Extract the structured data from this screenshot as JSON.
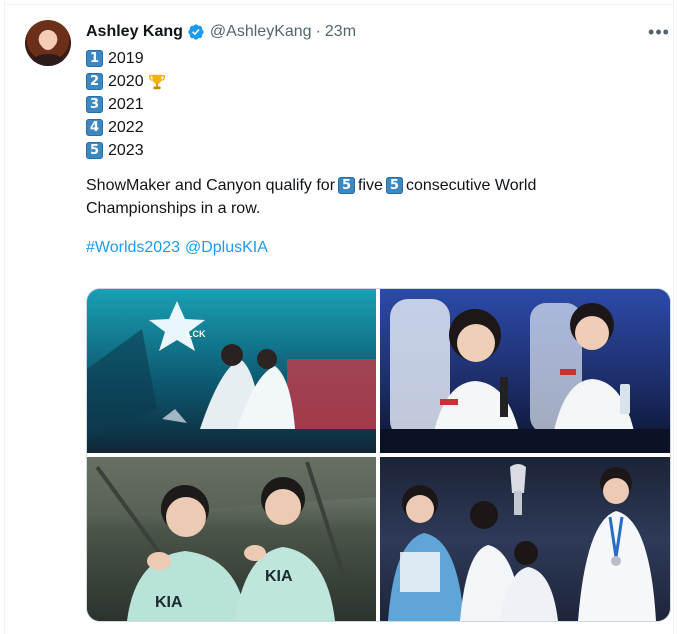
{
  "tweet": {
    "author_name": "Ashley Kang",
    "handle": "@AshleyKang",
    "separator": "·",
    "time": "23m",
    "more_label": "•••",
    "year_list": [
      {
        "number": "1",
        "year": "2019"
      },
      {
        "number": "2",
        "year": "2020"
      },
      {
        "number": "3",
        "year": "2021"
      },
      {
        "number": "4",
        "year": "2022"
      },
      {
        "number": "5",
        "year": "2023"
      }
    ],
    "body_line1_start": "ShowMaker and Canyon qualify for",
    "five_emoji": "5",
    "five_word": "five",
    "body_line1_end": "consecutive World",
    "body_line2": "Championships in a row.",
    "hashtag": "#Worlds2023",
    "mention": "@DplusKIA"
  },
  "media": {
    "photos": [
      {
        "label": "LCK"
      },
      {
        "label": ""
      },
      {
        "label": "KIA"
      },
      {
        "label": ""
      }
    ]
  },
  "colors": {
    "link": "#1d9bf0",
    "verified": "#1d9bf0",
    "secondary_text": "#536471",
    "keycap": "#3b88c3"
  }
}
